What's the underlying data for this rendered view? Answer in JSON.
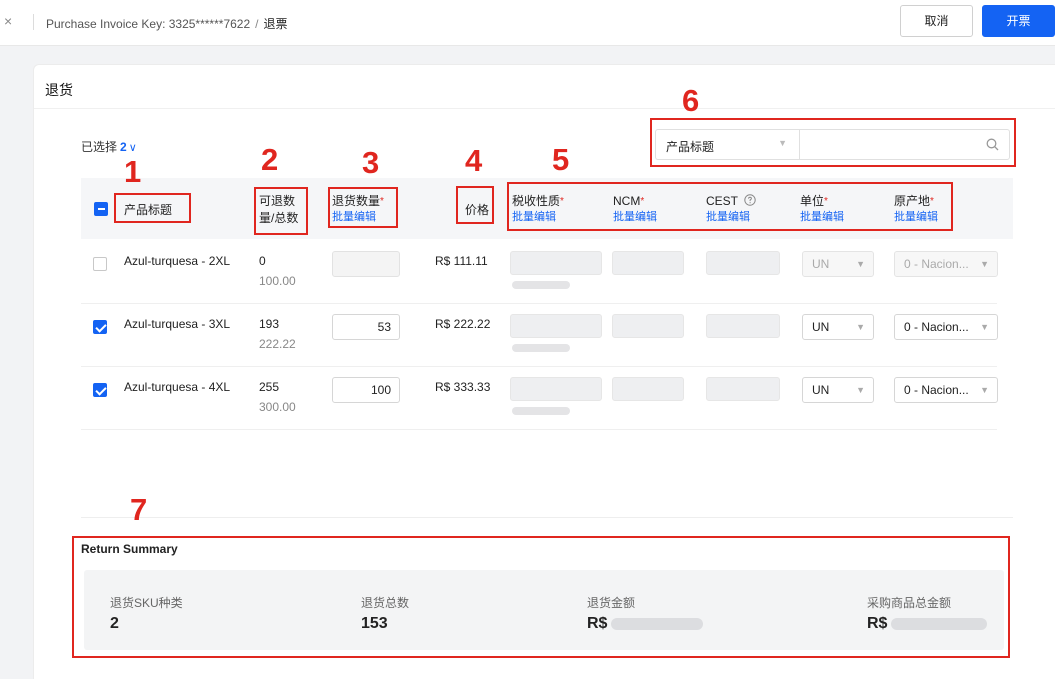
{
  "header": {
    "close_glyph": "×",
    "breadcrumb_key": "Purchase Invoice Key: 3325******7622",
    "breadcrumb_sep": "/",
    "breadcrumb_current": "退票",
    "cancel_label": "取消",
    "submit_label": "开票"
  },
  "card": {
    "title": "退货"
  },
  "selection": {
    "label": "已选择",
    "count": "2",
    "chevron": "∨"
  },
  "search": {
    "field_label": "产品标题",
    "placeholder": ""
  },
  "columns": {
    "product_title": "产品标题",
    "returnable_line1": "可退数",
    "returnable_line2": "量/总数",
    "return_qty": "退货数量",
    "price": "价格",
    "tax_nature": "税收性质",
    "ncm": "NCM",
    "cest": "CEST",
    "unit": "单位",
    "origin": "原产地",
    "bulk_edit": "批量编辑",
    "required_mark": "*"
  },
  "rows": [
    {
      "checked": false,
      "title": "Azul-turquesa - 2XL",
      "returnable": "0",
      "total": "100.00",
      "qty": "",
      "price": "R$ 111.11",
      "unit": "UN",
      "origin": "0 - Nacion..."
    },
    {
      "checked": true,
      "title": "Azul-turquesa - 3XL",
      "returnable": "193",
      "total": "222.22",
      "qty": "53",
      "price": "R$ 222.22",
      "unit": "UN",
      "origin": "0 - Nacion..."
    },
    {
      "checked": true,
      "title": "Azul-turquesa - 4XL",
      "returnable": "255",
      "total": "300.00",
      "qty": "100",
      "price": "R$ 333.33",
      "unit": "UN",
      "origin": "0 - Nacion..."
    }
  ],
  "summary": {
    "title": "Return Summary",
    "sku_label": "退货SKU种类",
    "sku_value": "2",
    "total_label": "退货总数",
    "total_value": "153",
    "amount_label": "退货金额",
    "amount_prefix": "R$",
    "purchase_label": "采购商品总金额",
    "purchase_prefix": "R$"
  },
  "annotations": [
    "1",
    "2",
    "3",
    "4",
    "5",
    "6",
    "7"
  ],
  "colors": {
    "primary": "#1463f3",
    "annotation_red": "#e0261f"
  }
}
